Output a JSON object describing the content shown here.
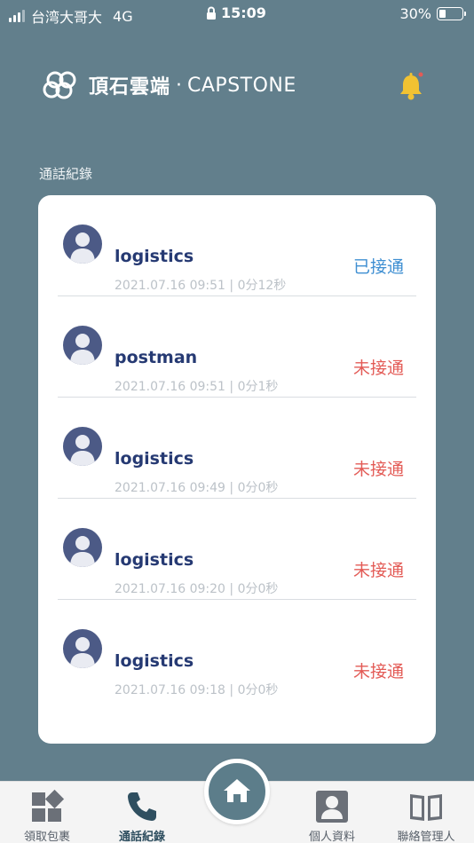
{
  "status_bar": {
    "carrier": "台湾大哥大",
    "network": "4G",
    "time": "15:09",
    "battery": "30%",
    "battery_level": 0.3
  },
  "header": {
    "brand_name": "頂石雲端",
    "brand_separator": "·",
    "brand_latin": "CAPSTONE"
  },
  "section": {
    "title": "通話紀錄"
  },
  "calls": [
    {
      "name": "logistics",
      "meta": "2021.07.16 09:51 | 0分12秒",
      "status": "已接通",
      "status_type": "answered"
    },
    {
      "name": "postman",
      "meta": "2021.07.16 09:51 | 0分1秒",
      "status": "未接通",
      "status_type": "missed"
    },
    {
      "name": "logistics",
      "meta": "2021.07.16 09:49 | 0分0秒",
      "status": "未接通",
      "status_type": "missed"
    },
    {
      "name": "logistics",
      "meta": "2021.07.16 09:20 | 0分0秒",
      "status": "未接通",
      "status_type": "missed"
    },
    {
      "name": "logistics",
      "meta": "2021.07.16 09:18 | 0分0秒",
      "status": "未接通",
      "status_type": "missed"
    }
  ],
  "nav": {
    "items": [
      {
        "label": "領取包裹",
        "icon": "package-grid-icon"
      },
      {
        "label": "通話紀錄",
        "icon": "phone-icon",
        "active": true
      },
      {
        "label": "個人資料",
        "icon": "profile-card-icon"
      },
      {
        "label": "聯絡管理人",
        "icon": "book-icon"
      }
    ],
    "home_icon": "home-icon"
  },
  "colors": {
    "background": "#627f8c",
    "answered": "#3f8fd2",
    "missed": "#e35b56",
    "name": "#263a73",
    "bell": "#f1c232"
  }
}
